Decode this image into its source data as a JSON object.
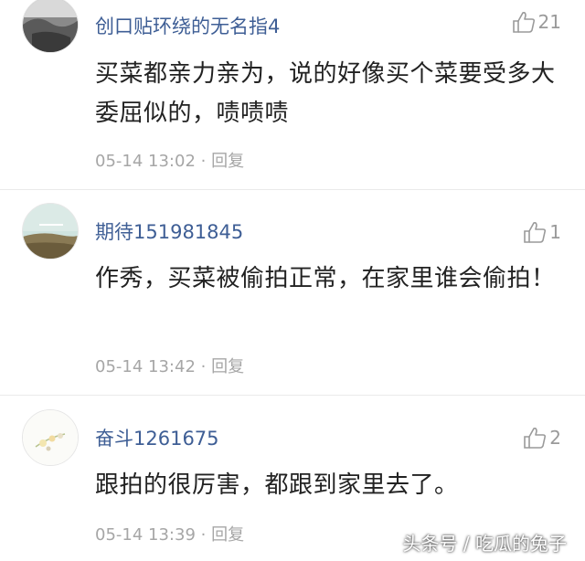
{
  "comments": [
    {
      "username": "创口贴环绕的无名指4",
      "likes": "21",
      "text": "买菜都亲力亲为，说的好像买个菜要受多大委屈似的，啧啧啧",
      "time": "05-14 13:02",
      "reply": "回复",
      "avatar_icon": "grayscale-photo-avatar"
    },
    {
      "username": "期待151981845",
      "likes": "1",
      "text": "作秀，买菜被偷拍正常，在家里谁会偷拍！",
      "time": "05-14 13:42",
      "reply": "回复",
      "avatar_icon": "landscape-photo-avatar"
    },
    {
      "username": "奋斗1261675",
      "likes": "2",
      "text": "跟拍的很厉害，都跟到家里去了。",
      "time": "05-14 13:39",
      "reply": "回复",
      "avatar_icon": "flower-photo-avatar"
    }
  ],
  "meta_separator": " · ",
  "watermark": "头条号 / 吃瓜的兔子",
  "colors": {
    "username": "#3e5e95",
    "meta": "#a6a6a6",
    "text": "#222222"
  }
}
